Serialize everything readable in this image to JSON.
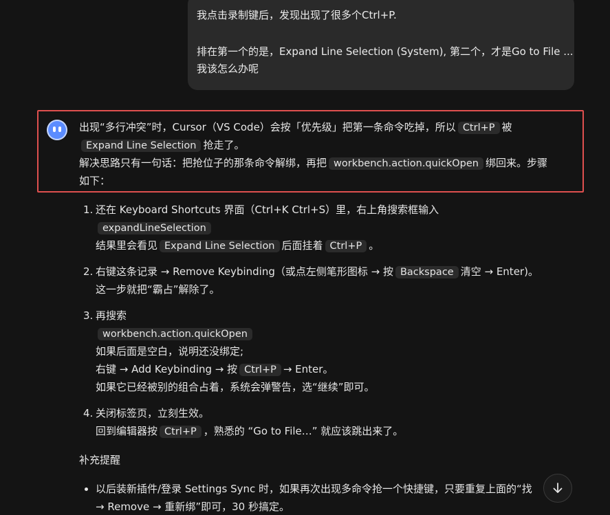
{
  "user_message": {
    "line1": "我点击录制键后，发现出现了很多个Ctrl+P.",
    "line2": "排在第一个的是，Expand Line Selection (System), 第二个，才是Go to File ...",
    "line3": "我该怎么办呢"
  },
  "assistant": {
    "intro": {
      "p1_a": "出现“多行冲突”时，Cursor（VS Code）会按「优先级」把第一条命令吃掉，所以",
      "p1_code": "Ctrl+P",
      "p1_b": "被",
      "p2_code": "Expand Line Selection",
      "p2_b": "抢走了。",
      "p3_a": "解决思路只有一句话：把抢位子的那条命令解绑，再把",
      "p3_code": "workbench.action.quickOpen",
      "p3_b": "绑回来。步骤",
      "p4": "如下："
    },
    "steps": [
      {
        "num": "1.",
        "l1": "还在 Keyboard Shortcuts 界面（Ctrl+K Ctrl+S）里，右上角搜索框输入",
        "l2_code": "expandLineSelection",
        "l3_a": "结果里会看见",
        "l3_code1": "Expand Line Selection",
        "l3_b": "后面挂着",
        "l3_code2": "Ctrl+P",
        "l3_c": "。"
      },
      {
        "num": "2.",
        "l1_a": "右键这条记录 → Remove Keybinding（或点左侧笔形图标 → 按",
        "l1_code": "Backspace",
        "l1_b": "清空 → Enter)。",
        "l2": "这一步就把“霸占”解除了。"
      },
      {
        "num": "3.",
        "l1": "再搜索",
        "l2_code": "workbench.action.quickOpen",
        "l3": "如果后面是空白，说明还没绑定;",
        "l4_a": "右键 → Add Keybinding → 按",
        "l4_code": "Ctrl+P",
        "l4_b": "→ Enter。",
        "l5": "如果它已经被别的组合占着，系统会弹警告，选“继续”即可。"
      },
      {
        "num": "4.",
        "l1": "关闭标签页，立刻生效。",
        "l2_a": "回到编辑器按",
        "l2_code": "Ctrl+P",
        "l2_b": "，熟悉的 “Go to File…” 就应该跳出来了。"
      }
    ],
    "supplement_title": "补充提醒",
    "bullet": {
      "l1": "以后装新插件/登录 Settings Sync 时，如果再次出现多命令抢一个快捷键，只要重复上面的“找",
      "l2": "→ Remove → 重新绑”即可，30 秒搞定。"
    }
  },
  "scroll_button": {
    "glyph": "↓"
  },
  "colors": {
    "background": "#141414",
    "highlight_border": "#e0504f",
    "avatar": "#5b8cff"
  }
}
